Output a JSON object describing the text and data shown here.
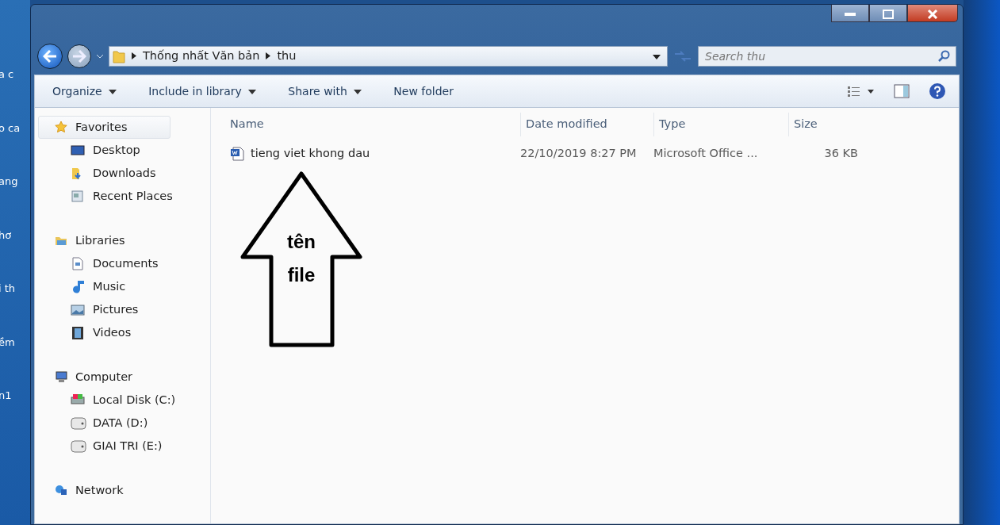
{
  "desktop_labels": [
    "a c",
    "o ca",
    "ang",
    "hơ",
    "i th",
    "ềm",
    "n1"
  ],
  "address_bar": {
    "path": [
      "Thống nhất Văn bản",
      "thu"
    ]
  },
  "search": {
    "placeholder": "Search thu"
  },
  "toolbar": {
    "menus": [
      "Organize",
      "Include in library",
      "Share with"
    ],
    "buttons": [
      "New folder"
    ]
  },
  "sidebar": {
    "groups": [
      {
        "label": "Favorites",
        "selected": true,
        "children": [
          {
            "label": "Desktop",
            "selected": false
          },
          {
            "label": "Downloads",
            "selected": false
          },
          {
            "label": "Recent Places",
            "selected": false
          }
        ]
      },
      {
        "label": "Libraries",
        "selected": false,
        "children": [
          {
            "label": "Documents",
            "selected": false
          },
          {
            "label": "Music",
            "selected": false
          },
          {
            "label": "Pictures",
            "selected": false
          },
          {
            "label": "Videos",
            "selected": false
          }
        ]
      },
      {
        "label": "Computer",
        "selected": false,
        "children": [
          {
            "label": "Local Disk (C:)",
            "selected": false
          },
          {
            "label": "DATA (D:)",
            "selected": false
          },
          {
            "label": "GIAI TRI (E:)",
            "selected": false
          }
        ]
      },
      {
        "label": "Network",
        "selected": false
      }
    ]
  },
  "table": {
    "columns": [
      "Name",
      "Date modified",
      "Type",
      "Size"
    ],
    "rows": [
      {
        "name": "tieng viet khong dau",
        "date_modified": "22/10/2019 8:27 PM",
        "type": "Microsoft Office ...",
        "size": "36 KB"
      }
    ]
  },
  "annotation": {
    "lines": [
      "tên",
      "file"
    ]
  }
}
